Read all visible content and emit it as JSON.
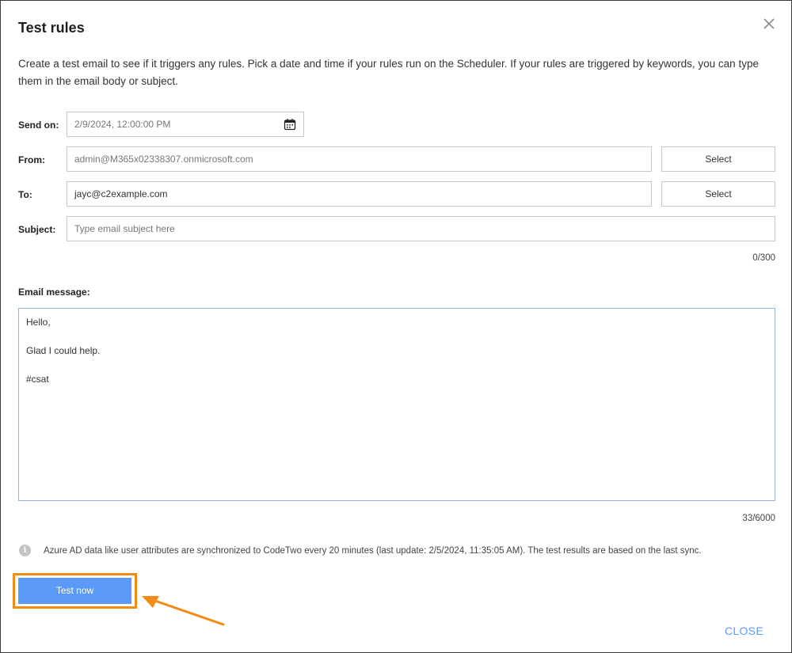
{
  "dialog": {
    "title": "Test rules",
    "intro": "Create a test email to see if it triggers any rules. Pick a date and time if your rules run on the Scheduler. If your rules are triggered by keywords, you can type them in the email body or subject.",
    "close_label": "CLOSE"
  },
  "form": {
    "send_on": {
      "label": "Send on:",
      "value": "2/9/2024, 12:00:00 PM"
    },
    "from": {
      "label": "From:",
      "value": "admin@M365x02338307.onmicrosoft.com",
      "select_label": "Select"
    },
    "to": {
      "label": "To:",
      "value": "jayc@c2example.com",
      "select_label": "Select"
    },
    "subject": {
      "label": "Subject:",
      "placeholder": "Type email subject here",
      "counter": "0/300"
    },
    "message": {
      "label": "Email message:",
      "lines": [
        "Hello,",
        "",
        "Glad I could help.",
        "",
        "#csat"
      ],
      "counter": "33/6000"
    }
  },
  "info": {
    "icon": "info-icon",
    "text": "Azure AD data like user attributes are synchronized to CodeTwo every 20 minutes (last update: 2/5/2024, 11:35:05 AM). The test results are based on the last sync."
  },
  "actions": {
    "test_now_label": "Test now"
  },
  "colors": {
    "accent": "#5b9af5",
    "highlight": "#f28c18",
    "border": "#c8c8c8"
  }
}
